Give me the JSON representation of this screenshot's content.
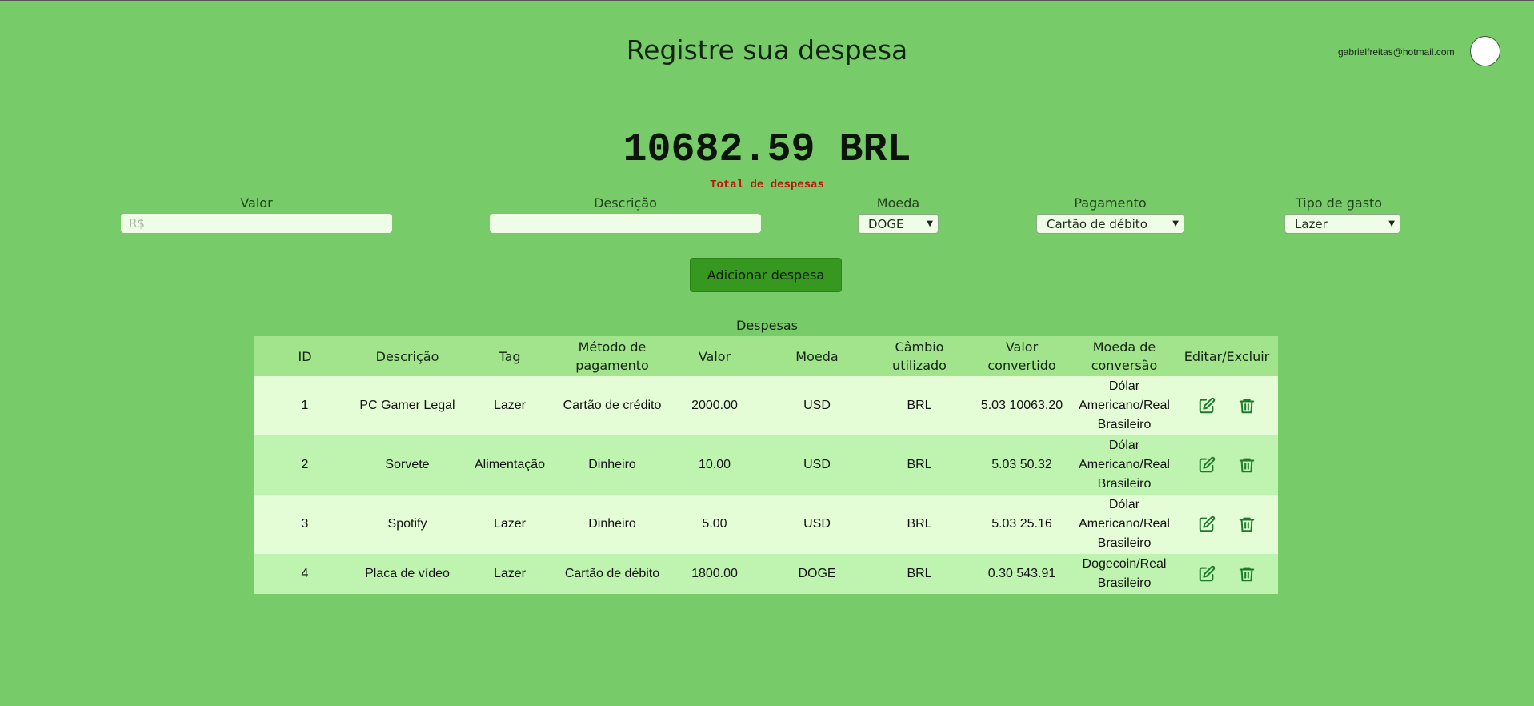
{
  "header": {
    "title": "Registre sua despesa",
    "email": "gabrielfreitas@hotmail.com"
  },
  "summary": {
    "total": "10682.59 BRL",
    "label": "Total de despesas"
  },
  "form": {
    "valor_label": "Valor",
    "valor_placeholder": "R$",
    "valor_value": "",
    "descricao_label": "Descrição",
    "descricao_value": "",
    "moeda_label": "Moeda",
    "moeda_selected": "DOGE",
    "pagamento_label": "Pagamento",
    "pagamento_selected": "Cartão de débito",
    "tipo_label": "Tipo de gasto",
    "tipo_selected": "Lazer",
    "add_button": "Adicionar despesa"
  },
  "table": {
    "caption": "Despesas",
    "headers": [
      "ID",
      "Descrição",
      "Tag",
      "Método de pagamento",
      "Valor",
      "Moeda",
      "Câmbio utilizado",
      "Valor convertido",
      "Moeda de conversão",
      "Editar/Excluir"
    ],
    "rows": [
      {
        "id": "1",
        "descricao": "PC Gamer Legal",
        "tag": "Lazer",
        "metodo": "Cartão de crédito",
        "valor": "2000.00",
        "moeda": "USD",
        "cambio": "BRL",
        "convertido": "5.03 10063.20",
        "conversao": "Dólar Americano/Real Brasileiro"
      },
      {
        "id": "2",
        "descricao": "Sorvete",
        "tag": "Alimentação",
        "metodo": "Dinheiro",
        "valor": "10.00",
        "moeda": "USD",
        "cambio": "BRL",
        "convertido": "5.03 50.32",
        "conversao": "Dólar Americano/Real Brasileiro"
      },
      {
        "id": "3",
        "descricao": "Spotify",
        "tag": "Lazer",
        "metodo": "Dinheiro",
        "valor": "5.00",
        "moeda": "USD",
        "cambio": "BRL",
        "convertido": "5.03 25.16",
        "conversao": "Dólar Americano/Real Brasileiro"
      },
      {
        "id": "4",
        "descricao": "Placa de vídeo",
        "tag": "Lazer",
        "metodo": "Cartão de débito",
        "valor": "1800.00",
        "moeda": "DOGE",
        "cambio": "BRL",
        "convertido": "0.30 543.91",
        "conversao": "Dogecoin/Real Brasileiro"
      }
    ]
  },
  "icons": {
    "edit": "edit-icon",
    "delete": "trash-icon"
  },
  "colors": {
    "background": "#77cb69",
    "button": "#37981f",
    "total_label": "#c1120b",
    "header_row": "#a1e48b",
    "row_light": "#e5fdd6",
    "row_dark": "#bff4b0",
    "icon": "#1d7a2c"
  }
}
